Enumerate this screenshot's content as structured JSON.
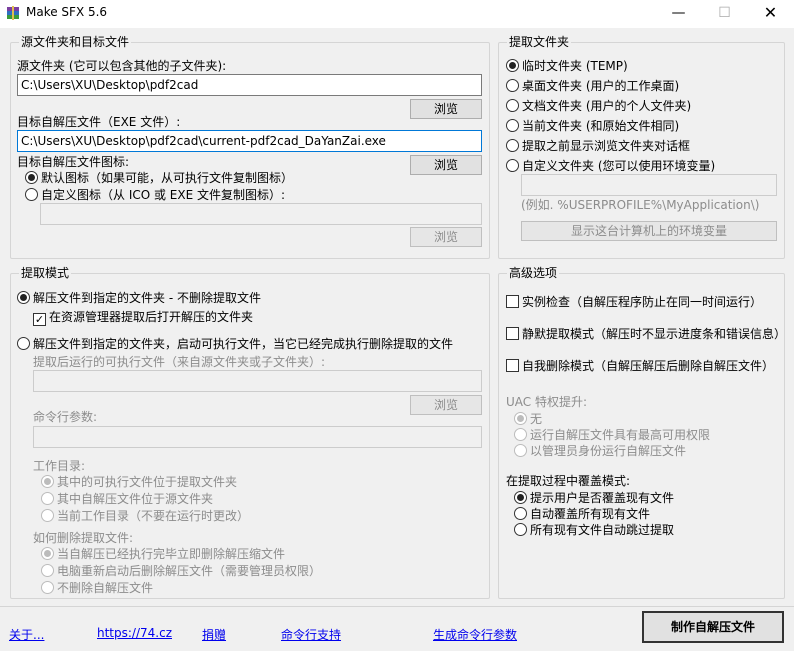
{
  "window": {
    "title": "Make SFX 5.6",
    "min": "—",
    "max": "☐",
    "close": "✕"
  },
  "source": {
    "legend": "源文件夹和目标文件",
    "src_label": "源文件夹 (它可以包含其他的子文件夹):",
    "src_value": "C:\\Users\\XU\\Desktop\\pdf2cad",
    "browse1": "浏览",
    "target_label": "目标自解压文件（EXE 文件）:",
    "target_value": "C:\\Users\\XU\\Desktop\\pdf2cad\\current-pdf2cad_DaYanZai.exe",
    "icon_label": "目标自解压文件图标:",
    "browse2": "浏览",
    "default_icon": "默认图标（如果可能，从可执行文件复制图标）",
    "custom_icon": "自定义图标（从 ICO 或 EXE 文件复制图标）:",
    "custom_icon_value": "",
    "browse3": "浏览"
  },
  "extract_folder": {
    "legend": "提取文件夹",
    "options": [
      {
        "label": "临时文件夹 (TEMP)",
        "checked": true
      },
      {
        "label": "桌面文件夹 (用户的工作桌面)",
        "checked": false
      },
      {
        "label": "文档文件夹 (用户的个人文件夹)",
        "checked": false
      },
      {
        "label": "当前文件夹 (和原始文件相同)",
        "checked": false
      },
      {
        "label": "提取之前显示浏览文件夹对话框",
        "checked": false
      },
      {
        "label": "自定义文件夹 (您可以使用环境变量)",
        "checked": false
      }
    ],
    "custom_value": "",
    "example": "(例如. %USERPROFILE%\\MyApplication\\)",
    "env_button": "显示这台计算机上的环境变量"
  },
  "extract_mode": {
    "legend": "提取模式",
    "mode1": "解压文件到指定的文件夹 - 不删除提取文件",
    "open_explorer": "在资源管理器提取后打开解压的文件夹",
    "mode2": "解压文件到指定的文件夹，启动可执行文件，当它已经完成执行删除提取的文件",
    "run_label": "提取后运行的可执行文件（来自源文件夹或子文件夹）:",
    "run_value": "",
    "browse4": "浏览",
    "cmd_label": "命令行参数:",
    "cmd_value": "",
    "workdir_label": "工作目录:",
    "workdir_opts": [
      {
        "label": "其中的可执行文件位于提取文件夹",
        "checked": true
      },
      {
        "label": "其中自解压文件位于源文件夹",
        "checked": false
      },
      {
        "label": "当前工作目录（不要在运行时更改）",
        "checked": false
      }
    ],
    "delete_label": "如何删除提取文件:",
    "delete_opts": [
      {
        "label": "当自解压已经执行完毕立即删除解压缩文件",
        "checked": true
      },
      {
        "label": "电脑重新启动后删除解压文件（需要管理员权限）",
        "checked": false
      },
      {
        "label": "不删除自解压文件",
        "checked": false
      }
    ]
  },
  "advanced": {
    "legend": "高级选项",
    "single_instance": "实例检查（自解压程序防止在同一时间运行）",
    "silent": "静默提取模式（解压时不显示进度条和错误信息）",
    "self_delete": "自我删除模式（自解压解压后删除自解压文件）",
    "uac_label": "UAC 特权提升:",
    "uac_opts": [
      {
        "label": "无",
        "checked": true
      },
      {
        "label": "运行自解压文件具有最高可用权限",
        "checked": false
      },
      {
        "label": "以管理员身份运行自解压文件",
        "checked": false
      }
    ],
    "overwrite_label": "在提取过程中覆盖模式:",
    "overwrite_opts": [
      {
        "label": "提示用户是否覆盖现有文件",
        "checked": true
      },
      {
        "label": "自动覆盖所有现有文件",
        "checked": false
      },
      {
        "label": "所有现有文件自动跳过提取",
        "checked": false
      }
    ]
  },
  "footer": {
    "about": "关于...",
    "site": "https://74.cz",
    "donate": "捐赠",
    "cmd_support": "命令行支持",
    "gen_cmd": "生成命令行参数",
    "make": "制作自解压文件"
  }
}
